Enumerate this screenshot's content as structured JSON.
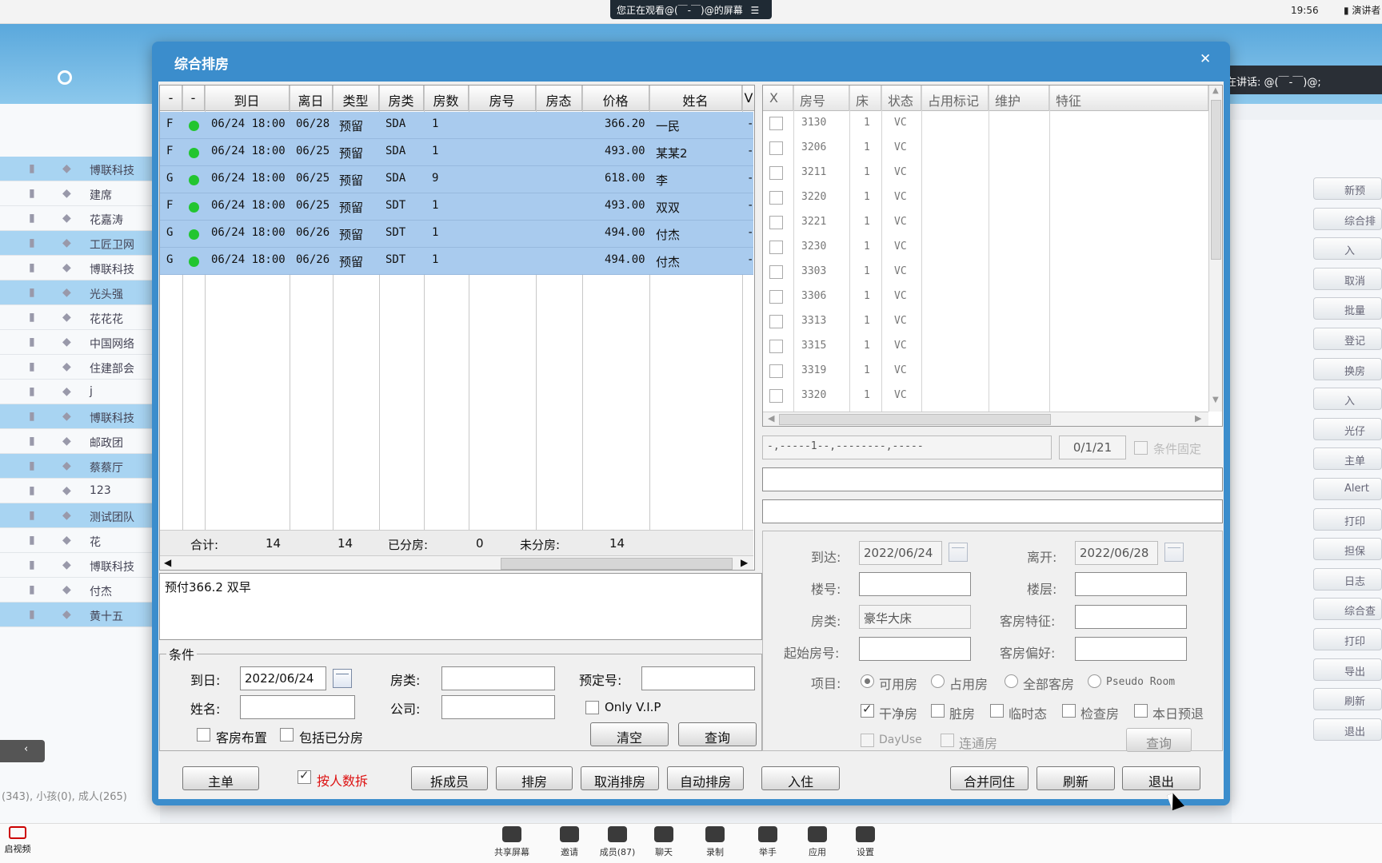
{
  "meeting": {
    "viewing_text": "您正在观看@(￣-￣)@的屏幕",
    "clock": "19:56",
    "presenter_label": "演讲者",
    "speaking_text": "正在讲话: @(￣-￣)@;",
    "taskbar": [
      {
        "label": "共享屏幕",
        "icon": "share-screen-icon"
      },
      {
        "label": "邀请",
        "icon": "invite-icon"
      },
      {
        "label": "成员(87)",
        "icon": "members-icon"
      },
      {
        "label": "聊天",
        "icon": "chat-icon"
      },
      {
        "label": "录制",
        "icon": "record-icon"
      },
      {
        "label": "举手",
        "icon": "raise-hand-icon"
      },
      {
        "label": "应用",
        "icon": "apps-icon"
      },
      {
        "label": "设置",
        "icon": "settings-icon"
      }
    ],
    "video_label": "启视频"
  },
  "background_app": {
    "list": [
      {
        "name": "博联科技",
        "sel": true
      },
      {
        "name": "建席",
        "sel": false
      },
      {
        "name": "花嘉涛",
        "sel": false
      },
      {
        "name": "工匠卫网",
        "sel": true
      },
      {
        "name": "博联科技",
        "sel": false
      },
      {
        "name": "光头强",
        "sel": true
      },
      {
        "name": "花花花",
        "sel": false
      },
      {
        "name": "中国网络",
        "sel": false
      },
      {
        "name": "住建部会",
        "sel": false
      },
      {
        "name": "j",
        "sel": false
      },
      {
        "name": "博联科技",
        "sel": true
      },
      {
        "name": "邮政团",
        "sel": false
      },
      {
        "name": "蔡蔡厅",
        "sel": true
      },
      {
        "name": "123",
        "sel": false
      },
      {
        "name": "测试团队",
        "sel": true
      },
      {
        "name": "花",
        "sel": false
      },
      {
        "name": "博联科技",
        "sel": false
      },
      {
        "name": "付杰",
        "sel": false
      },
      {
        "name": "黄十五",
        "sel": true
      }
    ],
    "buttons": [
      "新预",
      "综合排",
      "入",
      "取消",
      "批量",
      "登记",
      "换房",
      "入",
      "光仔",
      "主单",
      "Alert",
      "打印",
      "担保",
      "日志",
      "综合查",
      "打印",
      "导出",
      "刷新",
      "退出"
    ],
    "footer_text": "(343), 小孩(0), 成人(265)"
  },
  "dialog": {
    "title": "综合排房",
    "left_table": {
      "columns": [
        "-",
        "-",
        "到日",
        "离日",
        "类型",
        "房类",
        "房数",
        "房号",
        "房态",
        "价格",
        "姓名",
        "V"
      ],
      "rows": [
        {
          "f": "F",
          "arrive": "06/24 18:00",
          "leave": "06/28",
          "type": "预留",
          "room_type": "SDA",
          "count": "1",
          "room_no": "",
          "status": "",
          "price": "366.20",
          "name": "一民",
          "v": "-"
        },
        {
          "f": "F",
          "arrive": "06/24 18:00",
          "leave": "06/25",
          "type": "预留",
          "room_type": "SDA",
          "count": "1",
          "room_no": "",
          "status": "",
          "price": "493.00",
          "name": "某某2",
          "v": "-"
        },
        {
          "f": "G",
          "arrive": "06/24 18:00",
          "leave": "06/25",
          "type": "预留",
          "room_type": "SDA",
          "count": "9",
          "room_no": "",
          "status": "",
          "price": "618.00",
          "name": "李",
          "v": "-"
        },
        {
          "f": "F",
          "arrive": "06/24 18:00",
          "leave": "06/25",
          "type": "预留",
          "room_type": "SDT",
          "count": "1",
          "room_no": "",
          "status": "",
          "price": "493.00",
          "name": "双双",
          "v": "-"
        },
        {
          "f": "G",
          "arrive": "06/24 18:00",
          "leave": "06/26",
          "type": "预留",
          "room_type": "SDT",
          "count": "1",
          "room_no": "",
          "status": "",
          "price": "494.00",
          "name": "付杰",
          "v": "-"
        },
        {
          "f": "G",
          "arrive": "06/24 18:00",
          "leave": "06/26",
          "type": "预留",
          "room_type": "SDT",
          "count": "1",
          "room_no": "",
          "status": "",
          "price": "494.00",
          "name": "付杰",
          "v": "-"
        }
      ],
      "summary": {
        "total_label": "合计:",
        "total_a": "14",
        "total_b": "14",
        "assigned_label": "已分房:",
        "assigned": "0",
        "unassigned_label": "未分房:",
        "unassigned": "14"
      }
    },
    "memo": "预付366.2  双早",
    "conditions": {
      "legend": "条件",
      "arrive_label": "到日:",
      "arrive_value": "2022/06/24",
      "room_type_label": "房类:",
      "room_type_value": "",
      "booking_no_label": "预定号:",
      "booking_no_value": "",
      "name_label": "姓名:",
      "name_value": "",
      "company_label": "公司:",
      "company_value": "",
      "vip_label": "Only V.I.P",
      "layout_label": "客房布置",
      "include_label": "包括已分房",
      "clear_label": "清空",
      "query_label": "查询"
    },
    "right_table": {
      "columns": [
        "X",
        "房号",
        "床",
        "状态",
        "占用标记",
        "维护",
        "特征"
      ],
      "rows": [
        {
          "room": "3130",
          "bed": "1",
          "status": "VC"
        },
        {
          "room": "3206",
          "bed": "1",
          "status": "VC"
        },
        {
          "room": "3211",
          "bed": "1",
          "status": "VC"
        },
        {
          "room": "3220",
          "bed": "1",
          "status": "VC"
        },
        {
          "room": "3221",
          "bed": "1",
          "status": "VC"
        },
        {
          "room": "3230",
          "bed": "1",
          "status": "VC"
        },
        {
          "room": "3303",
          "bed": "1",
          "status": "VC"
        },
        {
          "room": "3306",
          "bed": "1",
          "status": "VC"
        },
        {
          "room": "3313",
          "bed": "1",
          "status": "VC"
        },
        {
          "room": "3315",
          "bed": "1",
          "status": "VC"
        },
        {
          "room": "3319",
          "bed": "1",
          "status": "VC"
        },
        {
          "room": "3320",
          "bed": "1",
          "status": "VC"
        }
      ]
    },
    "right_misc": {
      "pattern": "-,-----1--,--------,-----",
      "counter": "0/1/21",
      "fixed_label": "条件固定"
    },
    "right_form": {
      "arrive_label": "到达:",
      "arrive_value": "2022/06/24",
      "leave_label": "离开:",
      "leave_value": "2022/06/28",
      "building_label": "楼号:",
      "floor_label": "楼层:",
      "room_type_label": "房类:",
      "room_type_value": "豪华大床",
      "feature_label": "客房特征:",
      "start_room_label": "起始房号:",
      "pref_label": "客房偏好:",
      "item_label": "项目:",
      "radios": [
        "可用房",
        "占用房",
        "全部客房",
        "Pseudo Room"
      ],
      "checks": [
        "干净房",
        "脏房",
        "临时态",
        "检查房",
        "本日预退"
      ],
      "dayuse_label": "DayUse",
      "connect_label": "连通房",
      "query_label": "查询"
    },
    "bottom_buttons": {
      "main": "主单",
      "split_by_person": "按人数拆",
      "split_member": "拆成员",
      "assign": "排房",
      "cancel_assign": "取消排房",
      "auto_assign": "自动排房",
      "checkin": "入住",
      "merge": "合并同住",
      "refresh": "刷新",
      "exit": "退出"
    }
  }
}
